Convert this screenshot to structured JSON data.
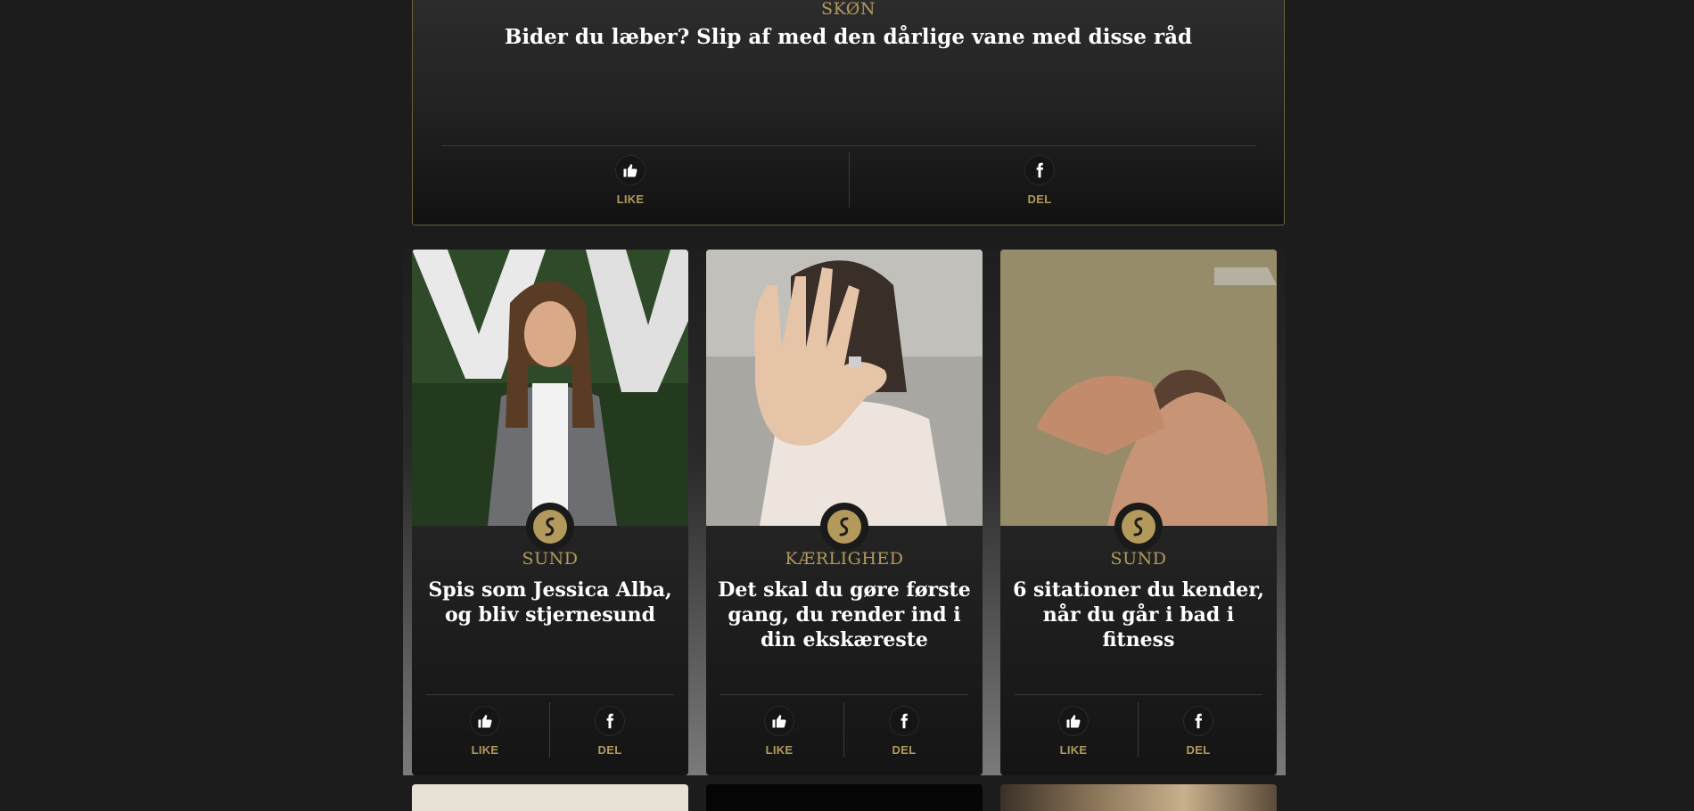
{
  "feature": {
    "category": "SKØN",
    "title": "Bider du læber? Slip af med den dårlige vane med disse råd",
    "like_label": "LIKE",
    "share_label": "DEL"
  },
  "cards": [
    {
      "category": "SUND",
      "title": "Spis som Jessica Alba, og bliv stjernesund",
      "like_label": "LIKE",
      "share_label": "DEL"
    },
    {
      "category": "KÆRLIGHED",
      "title": "Det skal du gøre første gang, du render ind i din ekskæreste",
      "like_label": "LIKE",
      "share_label": "DEL"
    },
    {
      "category": "SUND",
      "title": "6 sitationer du kender, når du går i bad i fitness",
      "like_label": "LIKE",
      "share_label": "DEL"
    }
  ],
  "colors": {
    "accent": "#b39a5c",
    "background": "#1c1c1c"
  },
  "icons": {
    "like": "thumbs-up-icon",
    "share": "facebook-icon",
    "brand": "brand-logo-icon"
  }
}
